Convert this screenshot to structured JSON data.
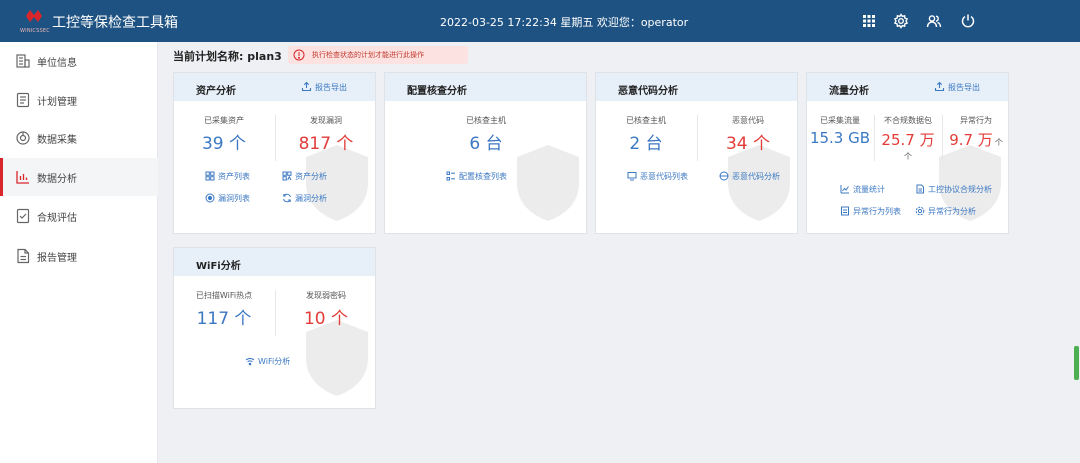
{
  "header": {
    "logo_text": "WINICSSEC",
    "title": "工控等保检查工具箱",
    "datetime": "2022-03-25 17:22:34",
    "weekday": "星期五",
    "welcome": "欢迎您：operator",
    "icons": [
      "grid-icon",
      "gear-icon",
      "users-icon",
      "power-icon"
    ]
  },
  "sidebar": {
    "items": [
      {
        "label": "单位信息",
        "icon": "building-icon"
      },
      {
        "label": "计划管理",
        "icon": "plan-icon"
      },
      {
        "label": "数据采集",
        "icon": "collect-icon"
      },
      {
        "label": "数据分析",
        "icon": "chart-icon",
        "active": true
      },
      {
        "label": "合规评估",
        "icon": "compliance-icon"
      },
      {
        "label": "报告管理",
        "icon": "report-icon"
      }
    ]
  },
  "main": {
    "plan_label": "当前计划名称:",
    "plan_name": "plan3",
    "warning": "执行检查状态的计划才能进行此操作"
  },
  "colors": {
    "header": "#1e5282",
    "accent_blue": "#3b78c2",
    "accent_red": "#e23c39",
    "active_bar": "#d9262b"
  },
  "cards": {
    "asset": {
      "title": "资产分析",
      "export": "报告导出",
      "stat1_label": "已采集资产",
      "stat1_value": "39 个",
      "stat2_label": "发现漏洞",
      "stat2_value": "817 个",
      "link1": "资产列表",
      "link2": "资产分析",
      "link3": "漏洞列表",
      "link4": "漏洞分析"
    },
    "config": {
      "title": "配置核查分析",
      "stat1_label": "已核查主机",
      "stat1_value": "6 台",
      "link1": "配置核查列表"
    },
    "malware": {
      "title": "恶意代码分析",
      "stat1_label": "已核查主机",
      "stat1_value": "2 台",
      "stat2_label": "恶意代码",
      "stat2_value": "34 个",
      "link1": "恶意代码列表",
      "link2": "恶意代码分析"
    },
    "traffic": {
      "title": "流量分析",
      "export": "报告导出",
      "stat1_label": "已采集流量",
      "stat1_value": "15.3 GB",
      "stat2_label": "不合规数据包",
      "stat2_value": "25.7 万",
      "stat2_unit": "个",
      "stat3_label": "异常行为",
      "stat3_value": "9.7 万",
      "stat3_unit": "个",
      "link1": "流量统计",
      "link2": "工控协议合规分析",
      "link3": "异常行为列表",
      "link4": "异常行为分析"
    },
    "wifi": {
      "title": "WiFi分析",
      "stat1_label": "已扫描WiFi热点",
      "stat1_value": "117 个",
      "stat2_label": "发现弱密码",
      "stat2_value": "10 个",
      "link1": "WiFi分析"
    }
  }
}
